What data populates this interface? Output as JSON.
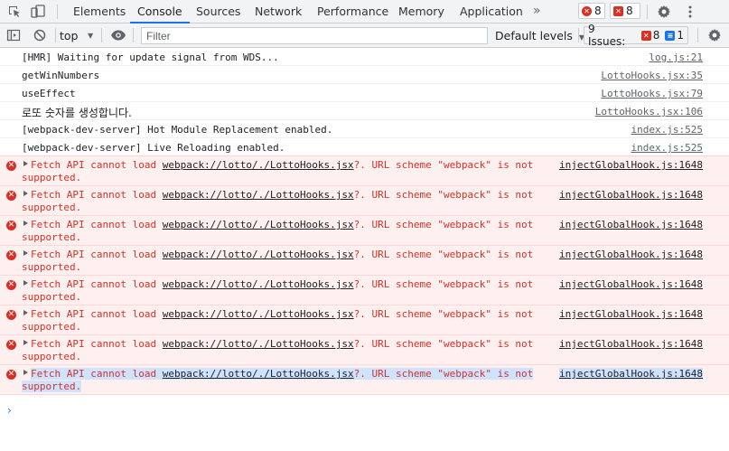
{
  "tabs": [
    "Elements",
    "Console",
    "Sources",
    "Network",
    "Performance",
    "Memory",
    "Application"
  ],
  "active_tab": "Console",
  "overflow_label": "»",
  "error_count": "8",
  "warning_count": "8",
  "toolbar": {
    "context": "top",
    "filter_placeholder": "Filter",
    "levels_label": "Default levels",
    "issues_label": "9 Issues:",
    "issues_errors": "8",
    "issues_info": "1"
  },
  "logs": [
    {
      "message": "[HMR] Waiting for update signal from WDS...",
      "source": "log.js:21"
    },
    {
      "message": "getWinNumbers",
      "source": "LottoHooks.jsx:35"
    },
    {
      "message": "useEffect",
      "source": "LottoHooks.jsx:79"
    },
    {
      "message": "로또 숫자를 생성합니다.",
      "source": "LottoHooks.jsx:106"
    },
    {
      "message": "[webpack-dev-server] Hot Module Replacement enabled.",
      "source": "index.js:525"
    },
    {
      "message": "[webpack-dev-server] Live Reloading enabled.",
      "source": "index.js:525"
    }
  ],
  "errors": [
    {
      "prefix": "Fetch API cannot load ",
      "link": "webpack://lotto/./LottoHooks.jsx",
      "suffix": "?. URL scheme \"webpack\" is not",
      "line2": "supported.",
      "source": "injectGlobalHook.js:1648"
    },
    {
      "prefix": "Fetch API cannot load ",
      "link": "webpack://lotto/./LottoHooks.jsx",
      "suffix": "?. URL scheme \"webpack\" is not",
      "line2": "supported.",
      "source": "injectGlobalHook.js:1648"
    },
    {
      "prefix": "Fetch API cannot load ",
      "link": "webpack://lotto/./LottoHooks.jsx",
      "suffix": "?. URL scheme \"webpack\" is not",
      "line2": "supported.",
      "source": "injectGlobalHook.js:1648"
    },
    {
      "prefix": "Fetch API cannot load ",
      "link": "webpack://lotto/./LottoHooks.jsx",
      "suffix": "?. URL scheme \"webpack\" is not",
      "line2": "supported.",
      "source": "injectGlobalHook.js:1648"
    },
    {
      "prefix": "Fetch API cannot load ",
      "link": "webpack://lotto/./LottoHooks.jsx",
      "suffix": "?. URL scheme \"webpack\" is not",
      "line2": "supported.",
      "source": "injectGlobalHook.js:1648"
    },
    {
      "prefix": "Fetch API cannot load ",
      "link": "webpack://lotto/./LottoHooks.jsx",
      "suffix": "?. URL scheme \"webpack\" is not",
      "line2": "supported.",
      "source": "injectGlobalHook.js:1648"
    },
    {
      "prefix": "Fetch API cannot load ",
      "link": "webpack://lotto/./LottoHooks.jsx",
      "suffix": "?. URL scheme \"webpack\" is not",
      "line2": "supported.",
      "source": "injectGlobalHook.js:1648"
    },
    {
      "prefix": "Fetch API cannot load ",
      "link": "webpack://lotto/./LottoHooks.jsx",
      "suffix": "?. URL scheme \"webpack\" is not",
      "line2": "supported.",
      "source": "injectGlobalHook.js:1648"
    }
  ],
  "prompt_symbol": "›",
  "colors": {
    "accent": "#1a73e8",
    "error": "#d93025",
    "error_bg": "#fff0f0",
    "selection": "#cfe2ff"
  }
}
